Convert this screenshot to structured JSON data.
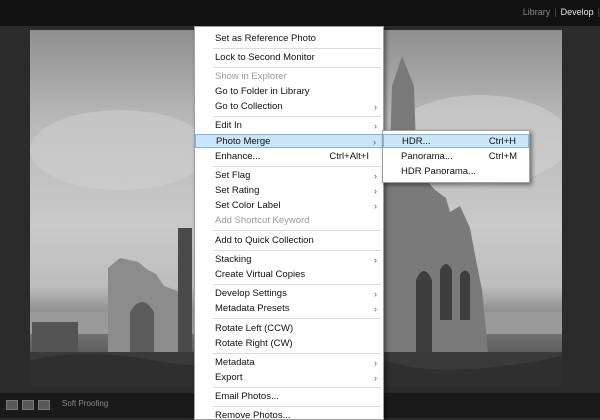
{
  "modules": {
    "library": "Library",
    "develop": "Develop",
    "separator": "|"
  },
  "bottombar": {
    "soft_proofing": "Soft Proofing"
  },
  "context_menu": {
    "items": [
      {
        "label": "Set as Reference Photo"
      },
      {
        "label": "Lock to Second Monitor"
      },
      {
        "label": "Show in Explorer",
        "disabled": true
      },
      {
        "label": "Go to Folder in Library"
      },
      {
        "label": "Go to Collection",
        "submenu": true
      },
      {
        "label": "Edit In",
        "submenu": true
      },
      {
        "label": "Photo Merge",
        "submenu": true,
        "highlighted": true
      },
      {
        "label": "Enhance...",
        "shortcut": "Ctrl+Alt+I"
      },
      {
        "label": "Set Flag",
        "submenu": true
      },
      {
        "label": "Set Rating",
        "submenu": true
      },
      {
        "label": "Set Color Label",
        "submenu": true
      },
      {
        "label": "Add Shortcut Keyword",
        "disabled": true
      },
      {
        "label": "Add to Quick Collection"
      },
      {
        "label": "Stacking",
        "submenu": true
      },
      {
        "label": "Create Virtual Copies"
      },
      {
        "label": "Develop Settings",
        "submenu": true
      },
      {
        "label": "Metadata Presets",
        "submenu": true
      },
      {
        "label": "Rotate Left (CCW)"
      },
      {
        "label": "Rotate Right (CW)"
      },
      {
        "label": "Metadata",
        "submenu": true
      },
      {
        "label": "Export",
        "submenu": true
      },
      {
        "label": "Email Photos..."
      },
      {
        "label": "Remove Photos..."
      }
    ],
    "arrow_glyph": "›"
  },
  "photo_merge_submenu": {
    "items": [
      {
        "label": "HDR...",
        "shortcut": "Ctrl+H",
        "highlighted": true
      },
      {
        "label": "Panorama...",
        "shortcut": "Ctrl+M"
      },
      {
        "label": "HDR Panorama..."
      }
    ]
  },
  "colors": {
    "menu_highlight": "#cce4f7",
    "menu_highlight_border": "#7fb6e0",
    "app_background": "#2b2b2b"
  }
}
